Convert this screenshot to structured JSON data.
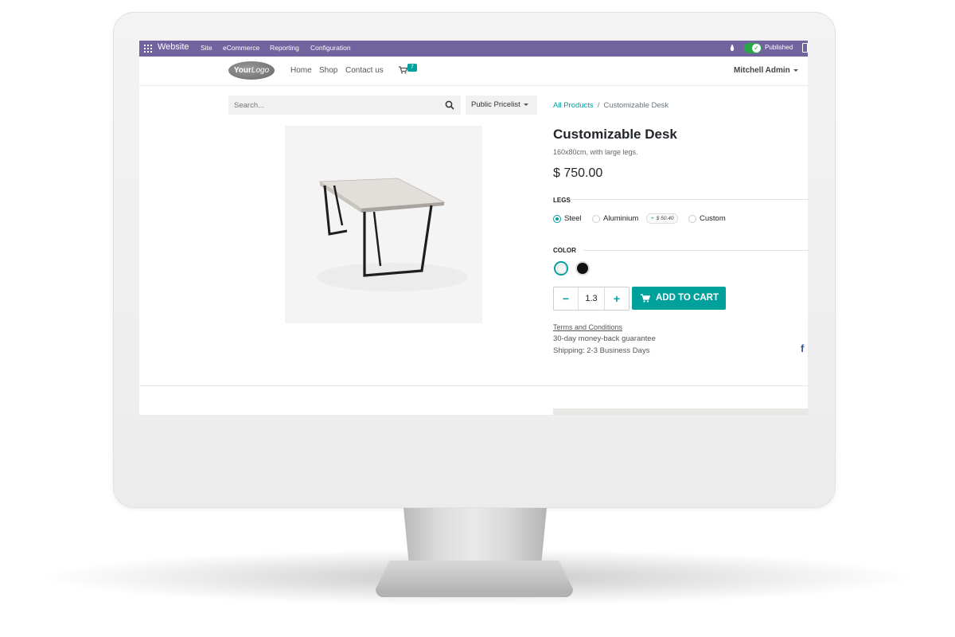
{
  "admin_bar": {
    "brand": "Website",
    "menu": [
      "Site",
      "eCommerce",
      "Reporting",
      "Configuration"
    ],
    "publish_status": "Published",
    "colors": {
      "bar": "#71639e",
      "toggle": "#28a745"
    }
  },
  "navbar": {
    "logo_text_bold": "Your",
    "logo_text": "Logo",
    "links": [
      "Home",
      "Shop",
      "Contact us"
    ],
    "cart_count": "7",
    "user": "Mitchell Admin"
  },
  "search": {
    "placeholder": "Search..."
  },
  "pricelist": {
    "label": "Public Pricelist"
  },
  "breadcrumb": {
    "parent": "All Products",
    "separator": "/",
    "current": "Customizable Desk"
  },
  "product": {
    "name": "Customizable Desk",
    "description": "160x80cm, with large legs.",
    "price": "$ 750.00",
    "legs": {
      "label": "LEGS",
      "options": [
        "Steel",
        "Aluminium",
        "Custom"
      ],
      "selected": "Steel",
      "extra_price": "$ 50.40"
    },
    "color": {
      "label": "COLOR",
      "swatches": [
        "#ffffff",
        "#111111"
      ],
      "selected": "white"
    },
    "quantity": "1.3",
    "add_to_cart": "ADD TO CART",
    "terms": "Terms and Conditions",
    "guarantee": "30-day money-back guarantee",
    "shipping": "Shipping: 2-3 Business Days"
  },
  "social": {
    "facebook": "f"
  },
  "accent_color": "#00a09d"
}
